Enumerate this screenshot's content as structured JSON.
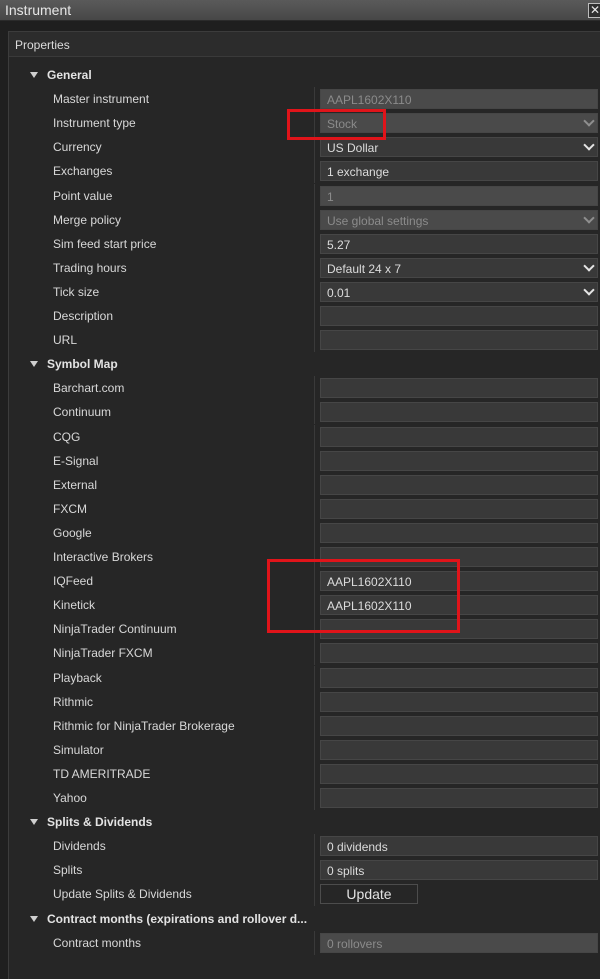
{
  "window": {
    "title": "Instrument",
    "close_glyph": "✕"
  },
  "panel": {
    "header": "Properties"
  },
  "rows": [
    {
      "kind": "category",
      "label": "General"
    },
    {
      "kind": "prop",
      "label": "Master instrument",
      "value": "AAPL1602X110",
      "disabled": true,
      "dropdown": false
    },
    {
      "kind": "prop",
      "label": "Instrument type",
      "value": "Stock",
      "disabled": true,
      "dropdown": true
    },
    {
      "kind": "prop",
      "label": "Currency",
      "value": "US Dollar",
      "disabled": false,
      "dropdown": true
    },
    {
      "kind": "prop",
      "label": "Exchanges",
      "value": "1 exchange",
      "disabled": false,
      "dropdown": false
    },
    {
      "kind": "prop",
      "label": "Point value",
      "value": "1",
      "disabled": true,
      "dropdown": false
    },
    {
      "kind": "prop",
      "label": "Merge policy",
      "value": "Use global settings",
      "disabled": true,
      "dropdown": true
    },
    {
      "kind": "prop",
      "label": "Sim feed start price",
      "value": "5.27",
      "disabled": false,
      "dropdown": false
    },
    {
      "kind": "prop",
      "label": "Trading hours",
      "value": "Default 24 x 7",
      "disabled": false,
      "dropdown": true
    },
    {
      "kind": "prop",
      "label": "Tick size",
      "value": "0.01",
      "disabled": false,
      "dropdown": true
    },
    {
      "kind": "prop",
      "label": "Description",
      "value": "",
      "disabled": false,
      "dropdown": false
    },
    {
      "kind": "prop",
      "label": "URL",
      "value": "",
      "disabled": false,
      "dropdown": false
    },
    {
      "kind": "category",
      "label": "Symbol Map"
    },
    {
      "kind": "prop",
      "label": "Barchart.com",
      "value": "",
      "disabled": false,
      "dropdown": false
    },
    {
      "kind": "prop",
      "label": "Continuum",
      "value": "",
      "disabled": false,
      "dropdown": false
    },
    {
      "kind": "prop",
      "label": "CQG",
      "value": "",
      "disabled": false,
      "dropdown": false
    },
    {
      "kind": "prop",
      "label": "E-Signal",
      "value": "",
      "disabled": false,
      "dropdown": false
    },
    {
      "kind": "prop",
      "label": "External",
      "value": "",
      "disabled": false,
      "dropdown": false
    },
    {
      "kind": "prop",
      "label": "FXCM",
      "value": "",
      "disabled": false,
      "dropdown": false
    },
    {
      "kind": "prop",
      "label": "Google",
      "value": "",
      "disabled": false,
      "dropdown": false
    },
    {
      "kind": "prop",
      "label": "Interactive Brokers",
      "value": "",
      "disabled": false,
      "dropdown": false
    },
    {
      "kind": "prop",
      "label": "IQFeed",
      "value": "AAPL1602X110",
      "disabled": false,
      "dropdown": false
    },
    {
      "kind": "prop",
      "label": "Kinetick",
      "value": "AAPL1602X110",
      "disabled": false,
      "dropdown": false
    },
    {
      "kind": "prop",
      "label": "NinjaTrader Continuum",
      "value": "",
      "disabled": false,
      "dropdown": false
    },
    {
      "kind": "prop",
      "label": "NinjaTrader FXCM",
      "value": "",
      "disabled": false,
      "dropdown": false
    },
    {
      "kind": "prop",
      "label": "Playback",
      "value": "",
      "disabled": false,
      "dropdown": false
    },
    {
      "kind": "prop",
      "label": "Rithmic",
      "value": "",
      "disabled": false,
      "dropdown": false
    },
    {
      "kind": "prop",
      "label": "Rithmic for NinjaTrader Brokerage",
      "value": "",
      "disabled": false,
      "dropdown": false
    },
    {
      "kind": "prop",
      "label": "Simulator",
      "value": "",
      "disabled": false,
      "dropdown": false
    },
    {
      "kind": "prop",
      "label": "TD AMERITRADE",
      "value": "",
      "disabled": false,
      "dropdown": false
    },
    {
      "kind": "prop",
      "label": "Yahoo",
      "value": "",
      "disabled": false,
      "dropdown": false
    },
    {
      "kind": "category",
      "label": "Splits & Dividends"
    },
    {
      "kind": "prop",
      "label": "Dividends",
      "value": "0 dividends",
      "disabled": false,
      "dropdown": false
    },
    {
      "kind": "prop",
      "label": "Splits",
      "value": "0 splits",
      "disabled": false,
      "dropdown": false
    },
    {
      "kind": "button",
      "label": "Update Splits & Dividends",
      "button_label": "Update"
    },
    {
      "kind": "category",
      "label": "Contract months (expirations and rollover d..."
    },
    {
      "kind": "prop",
      "label": "Contract months",
      "value": "0 rollovers",
      "disabled": true,
      "dropdown": false
    }
  ]
}
